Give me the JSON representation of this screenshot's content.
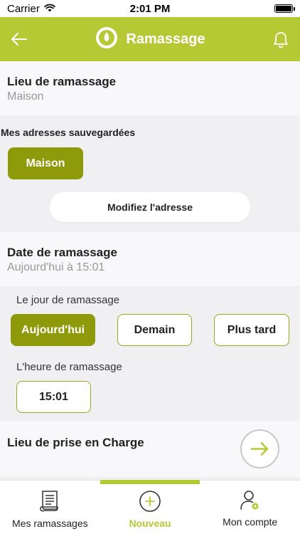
{
  "status_bar": {
    "carrier": "Carrier",
    "time": "2:01 PM"
  },
  "header": {
    "title": "Ramassage"
  },
  "pickup_location": {
    "title": "Lieu de ramassage",
    "value": "Maison"
  },
  "saved_addresses": {
    "label": "Mes adresses sauvegardées",
    "selected": "Maison",
    "modify_label": "Modifiez l'adresse"
  },
  "pickup_date": {
    "title": "Date de ramassage",
    "value": "Aujourd'hui à 15:01"
  },
  "day": {
    "label": "Le jour de ramassage",
    "options": [
      "Aujourd'hui",
      "Demain",
      "Plus tard"
    ],
    "selected": "Aujourd'hui"
  },
  "hour": {
    "label": "L'heure de ramassage",
    "value": "15:01"
  },
  "charge_location": {
    "title": "Lieu de prise en Charge"
  },
  "tabs": [
    {
      "label": "Mes ramassages",
      "icon": "receipt-icon"
    },
    {
      "label": "Nouveau",
      "icon": "plus-circle-icon",
      "active": true
    },
    {
      "label": "Mon compte",
      "icon": "user-icon"
    }
  ],
  "colors": {
    "accent": "#b5c935",
    "olive": "#8f9a0a",
    "muted": "#9a9a9a"
  }
}
